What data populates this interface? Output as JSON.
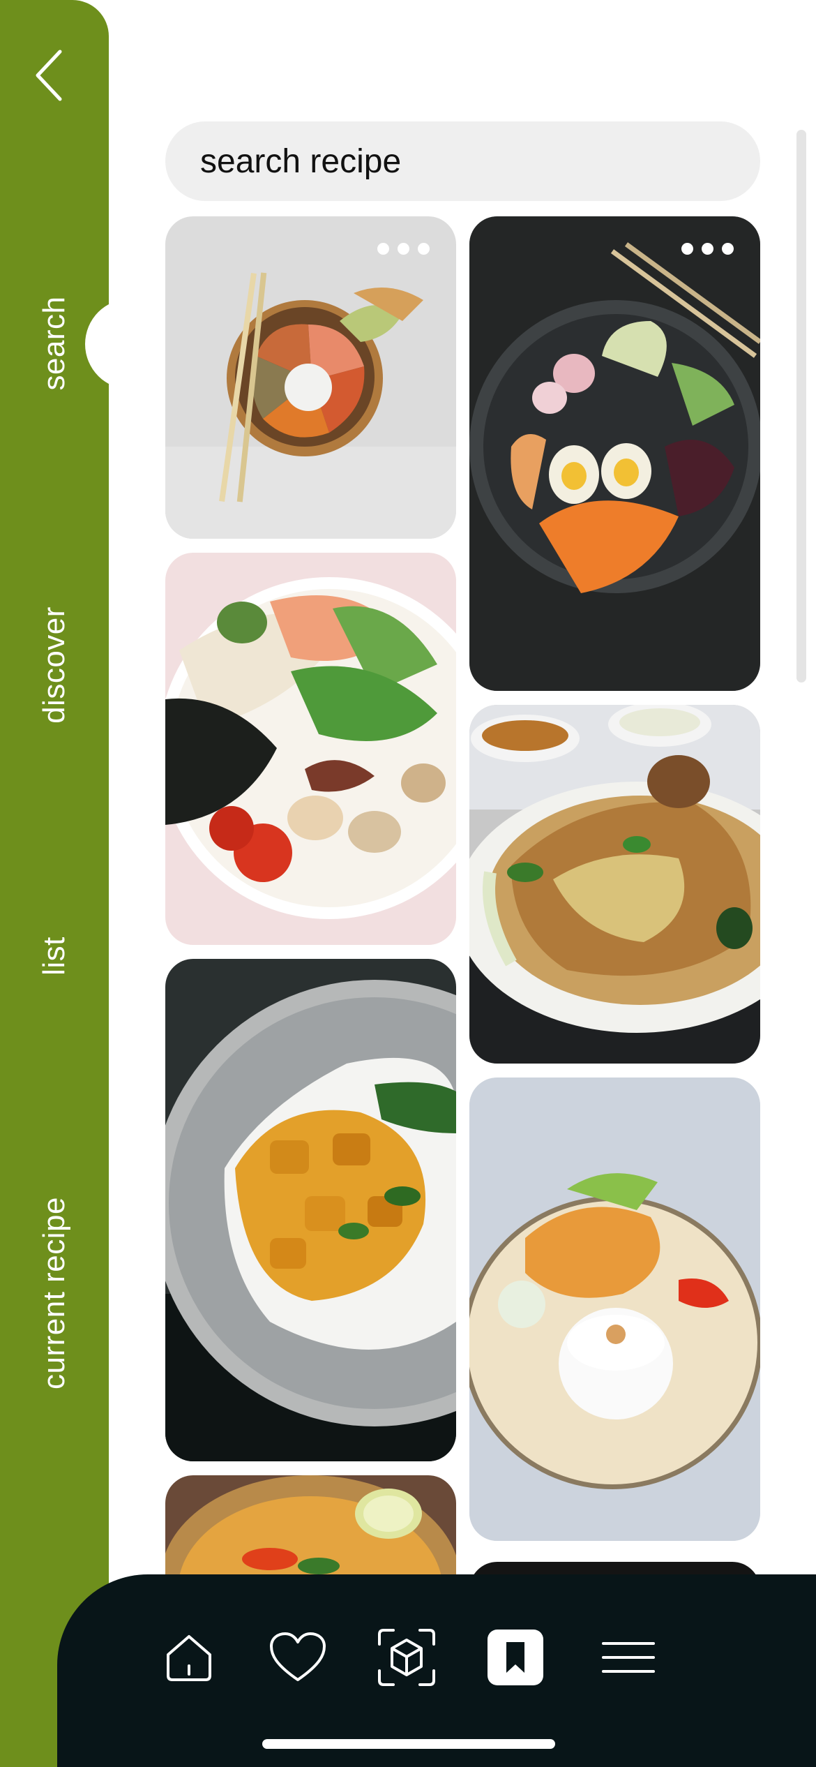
{
  "sidebar": {
    "back_icon": "chevron-left-icon",
    "tabs": [
      {
        "label": "search",
        "active": true
      },
      {
        "label": "discover",
        "active": false
      },
      {
        "label": "list",
        "active": false
      },
      {
        "label": "current recipe",
        "active": false
      }
    ],
    "color": "#6e8f1c"
  },
  "search": {
    "placeholder": "search recipe",
    "value": ""
  },
  "recipes": [
    {
      "name": "poke-bowl-chopsticks",
      "column": "left",
      "has_menu": true
    },
    {
      "name": "buddha-bowl-egg-carrot",
      "column": "right",
      "has_menu": true
    },
    {
      "name": "noodle-shrimp-bowl",
      "column": "left",
      "has_menu": false
    },
    {
      "name": "biryani-plate",
      "column": "right",
      "has_menu": false
    },
    {
      "name": "curry-rice-plate",
      "column": "left",
      "has_menu": false
    },
    {
      "name": "rice-shrimp-plate",
      "column": "right",
      "has_menu": false
    },
    {
      "name": "soup-bowl-lime",
      "column": "left",
      "has_menu": false
    }
  ],
  "bottom_nav": {
    "items": [
      {
        "icon": "home-icon",
        "active": false
      },
      {
        "icon": "heart-icon",
        "active": false
      },
      {
        "icon": "box-icon",
        "active": false
      },
      {
        "icon": "bookmark-icon",
        "active": true
      },
      {
        "icon": "menu-icon",
        "active": false
      }
    ],
    "color": "#081518"
  }
}
